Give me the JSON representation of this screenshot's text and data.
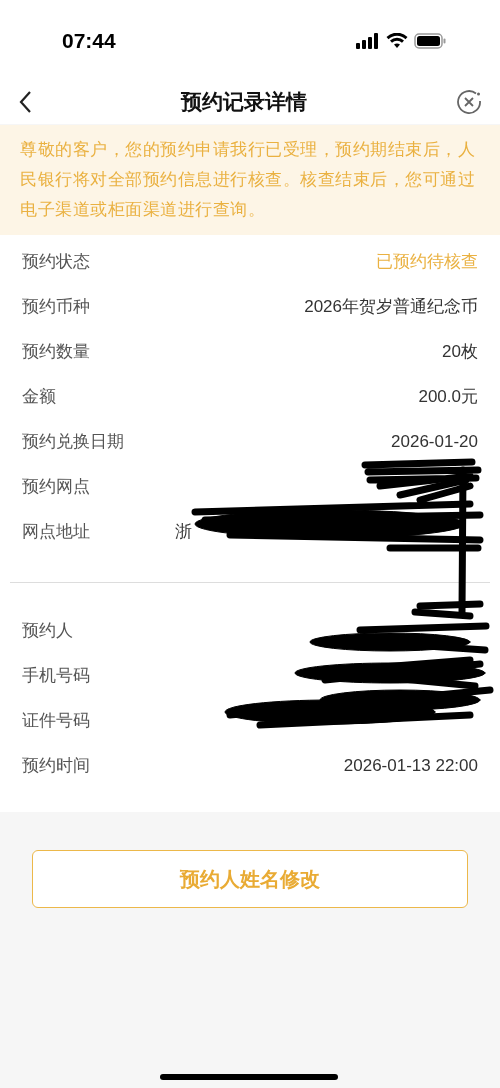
{
  "status_bar": {
    "time": "07:44"
  },
  "nav": {
    "title": "预约记录详情"
  },
  "notice": "尊敬的客户，您的预约申请我行已受理，预约期结束后，人民银行将对全部预约信息进行核查。核查结束后，您可通过电子渠道或柜面渠道进行查询。",
  "groups": [
    [
      {
        "label": "预约状态",
        "value": "已预约待核查",
        "kind": "status"
      },
      {
        "label": "预约币种",
        "value": "2026年贺岁普通纪念币",
        "kind": "right"
      },
      {
        "label": "预约数量",
        "value": "20枚",
        "kind": "right"
      },
      {
        "label": "金额",
        "value": "200.0元",
        "kind": "right"
      },
      {
        "label": "预约兑换日期",
        "value": "2026-01-20",
        "kind": "right"
      },
      {
        "label": "预约网点",
        "kind": "right"
      },
      {
        "label": "网点地址",
        "value": "浙",
        "kind": "left"
      }
    ],
    [
      {
        "label": "预约人",
        "kind": "right"
      },
      {
        "label": "手机号码",
        "kind": "right"
      },
      {
        "label": "证件号码",
        "kind": "right"
      },
      {
        "label": "预约时间",
        "value": "2026-01-13 22:00",
        "kind": "right"
      }
    ]
  ],
  "action_button": "预约人姓名修改"
}
